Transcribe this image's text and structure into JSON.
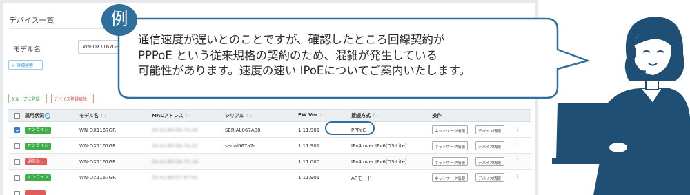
{
  "screen": {
    "title": "デバイス一覧",
    "model_label": "モデル名",
    "model_value": "WN-DX1167GR",
    "detail_search_button": "詳細検索",
    "group_register_button": "グループに登録",
    "device_unregister_button": "デバイス登録解除"
  },
  "table": {
    "headers": {
      "status": "運用状況",
      "model": "モデル名",
      "mac": "MACアドレス",
      "serial": "シリアル",
      "fw": "FW Ver",
      "connection": "接続方式",
      "actions": "操作"
    },
    "rows": [
      {
        "checked": true,
        "status": "オンライン",
        "status_color": "#3fae49",
        "model": "WN-DX1167GR",
        "mac": "50:41:B9:D6:7A:00",
        "serial": "SERIAL067A00",
        "fw": "1.11.901",
        "connection": "PPPoE",
        "btn_network": "ネットワーク情報",
        "btn_device": "デバイス情報"
      },
      {
        "checked": false,
        "status": "オンライン",
        "status_color": "#3fae49",
        "model": "WN-DX1167GR",
        "mac": "50:41:B9:D6:7A:2C",
        "serial": "serial067a2c",
        "fw": "1.11.901",
        "connection": "IPv4 over IPv6(DS-Lite)",
        "btn_network": "ネットワーク情報",
        "btn_device": "デバイス情報"
      },
      {
        "checked": false,
        "status": "通信なし",
        "status_color": "#e25b5b",
        "model": "WN-DX1167GR",
        "mac": "50:41:B9:D6:7C:18",
        "serial": "",
        "fw": "1.11.000",
        "connection": "IPv4 over IPv6(DS-Lite)",
        "btn_network": "ネットワーク情報",
        "btn_device": "デバイス情報"
      },
      {
        "checked": false,
        "status": "オンライン",
        "status_color": "#3fae49",
        "model": "WN-DX1167GR",
        "mac": "50:41:B9:D7:87:0C",
        "serial": "",
        "fw": "1.11.901",
        "connection": "APモード",
        "btn_network": "ネットワーク情報",
        "btn_device": "デバイス情報"
      }
    ]
  },
  "callout": {
    "tag": "例",
    "lines": [
      "通信速度が遅いとのことですが、確認したところ回線契約が",
      "PPPoE という従来規格の契約のため、混雑が発生している",
      "可能性があります。速度の速い IPoEについてご案内いたします。"
    ],
    "border_color": "#2f6f9e",
    "accent_color": "#2f6f9e"
  },
  "colors": {
    "online": "#3fae49",
    "offline": "#e25b5b",
    "link_blue": "#2d8bc9",
    "operator_navy": "#1f4f75"
  }
}
